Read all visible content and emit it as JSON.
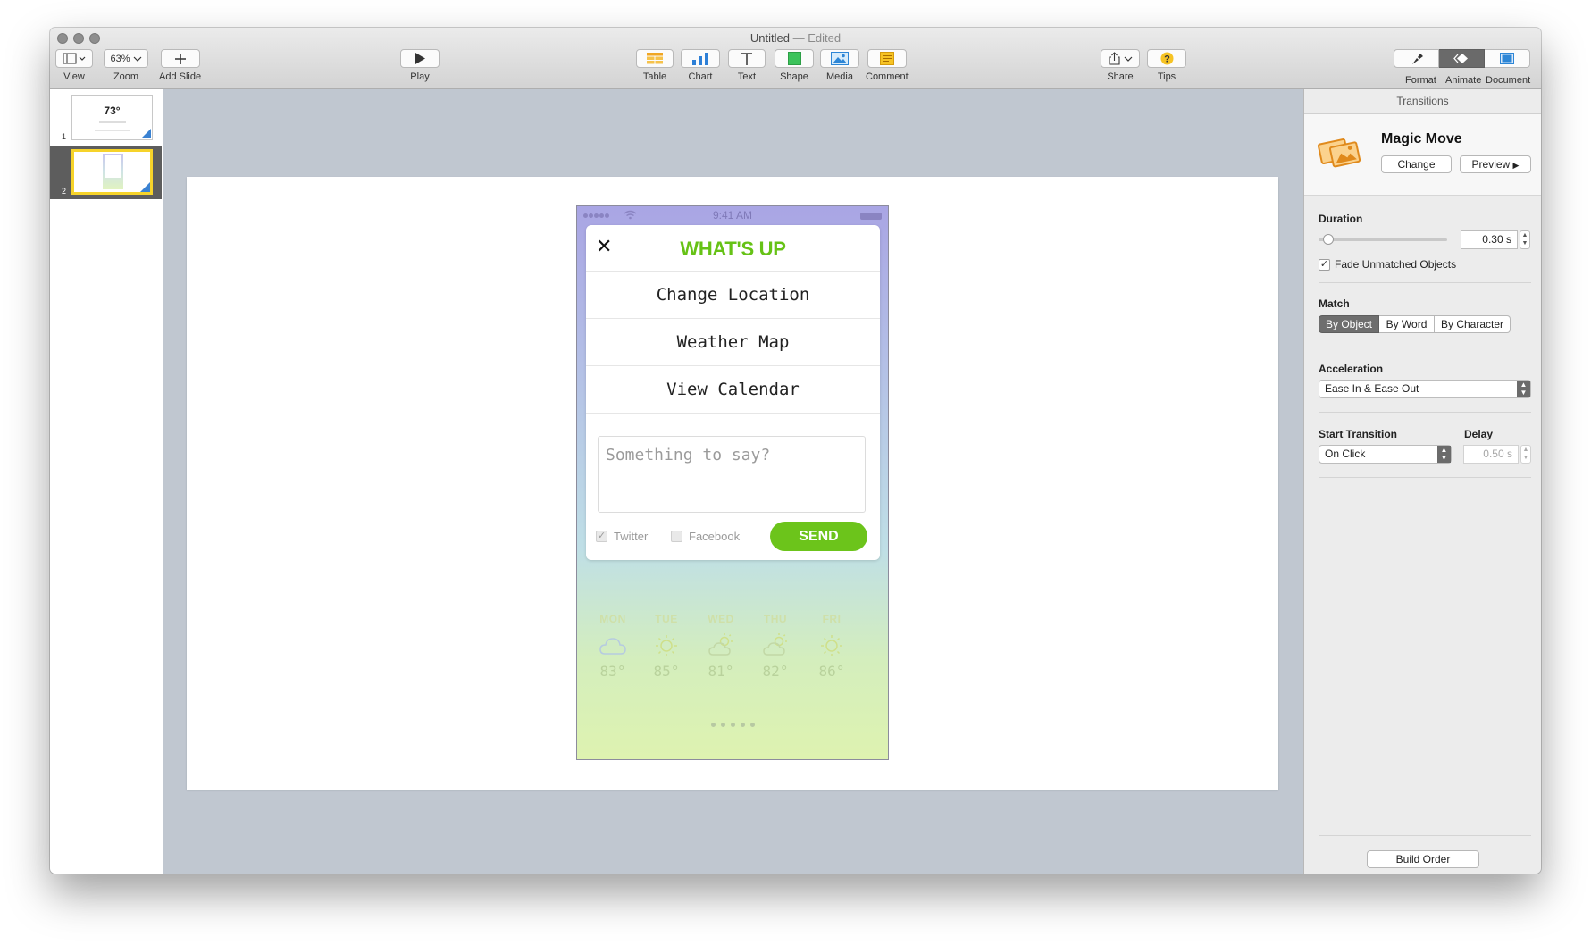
{
  "window": {
    "title": "Untitled",
    "title_sep": "—",
    "edited": "Edited"
  },
  "toolbar": {
    "view_label": "View",
    "zoom_value": "63%",
    "zoom_label": "Zoom",
    "add_slide_label": "Add Slide",
    "play_label": "Play",
    "table_label": "Table",
    "chart_label": "Chart",
    "text_label": "Text",
    "shape_label": "Shape",
    "media_label": "Media",
    "comment_label": "Comment",
    "share_label": "Share",
    "tips_label": "Tips",
    "format_label": "Format",
    "animate_label": "Animate",
    "document_label": "Document"
  },
  "navigator": {
    "slides": [
      {
        "number": "1",
        "thumb_text": "73°"
      },
      {
        "number": "2"
      }
    ]
  },
  "phone": {
    "status_time": "9:41 AM",
    "card_title": "WHAT'S UP",
    "menu_items": [
      "Change Location",
      "Weather Map",
      "View Calendar"
    ],
    "message_placeholder": "Something to say?",
    "twitter_label": "Twitter",
    "twitter_checked": true,
    "facebook_label": "Facebook",
    "facebook_checked": false,
    "send_label": "SEND",
    "forecast": [
      {
        "day": "MON",
        "icon": "cloud-icon",
        "temp": "83°"
      },
      {
        "day": "TUE",
        "icon": "sun-icon",
        "temp": "85°"
      },
      {
        "day": "WED",
        "icon": "partly-cloudy-icon",
        "temp": "81°"
      },
      {
        "day": "THU",
        "icon": "partly-cloudy-icon",
        "temp": "82°"
      },
      {
        "day": "FRI",
        "icon": "sun-icon",
        "temp": "86°"
      }
    ],
    "accent_color": "#6cc41b"
  },
  "inspector": {
    "tab_title": "Transitions",
    "effect_name": "Magic Move",
    "change_label": "Change",
    "preview_label": "Preview",
    "duration_label": "Duration",
    "duration_value": "0.30 s",
    "duration_slider_fraction": 0.04,
    "fade_label": "Fade Unmatched Objects",
    "fade_checked": true,
    "match_label": "Match",
    "match_options": [
      "By Object",
      "By Word",
      "By Character"
    ],
    "match_selected": "By Object",
    "acceleration_label": "Acceleration",
    "acceleration_value": "Ease In & Ease Out",
    "start_label": "Start Transition",
    "start_value": "On Click",
    "delay_label": "Delay",
    "delay_value": "0.50 s",
    "build_order_label": "Build Order"
  }
}
